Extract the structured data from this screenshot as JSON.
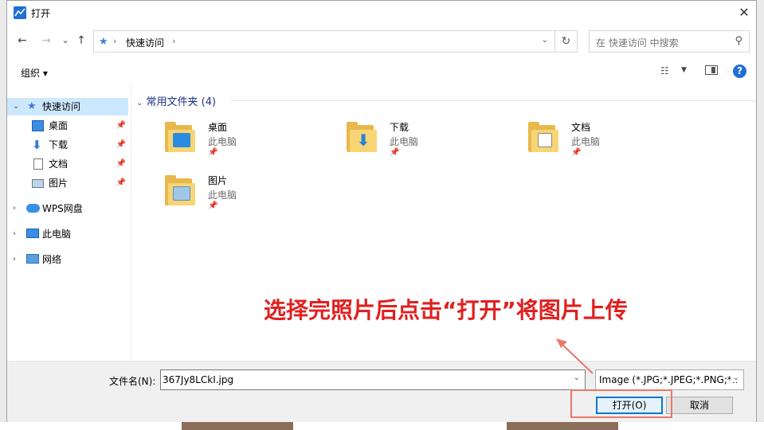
{
  "window": {
    "title": "打开"
  },
  "nav": {
    "back": "←",
    "forward": "→",
    "recent": "⌄",
    "up": "↑",
    "breadcrumb": "快速访问",
    "search_placeholder": "在 快速访问 中搜索"
  },
  "commandbar": {
    "organize": "组织 ▾"
  },
  "sidebar": {
    "items": [
      {
        "label": "快速访问",
        "icon": "star-pin-icon"
      },
      {
        "label": "桌面",
        "icon": "desktop-icon",
        "pinned": true
      },
      {
        "label": "下载",
        "icon": "download-icon",
        "pinned": true
      },
      {
        "label": "文档",
        "icon": "document-icon",
        "pinned": true
      },
      {
        "label": "图片",
        "icon": "pictures-icon",
        "pinned": true
      },
      {
        "label": "WPS网盘",
        "icon": "cloud-icon"
      },
      {
        "label": "此电脑",
        "icon": "computer-icon"
      },
      {
        "label": "网络",
        "icon": "network-icon"
      }
    ]
  },
  "main": {
    "group_header": "常用文件夹 (4)",
    "folders": [
      {
        "name": "桌面",
        "location": "此电脑"
      },
      {
        "name": "下载",
        "location": "此电脑"
      },
      {
        "name": "文档",
        "location": "此电脑"
      },
      {
        "name": "图片",
        "location": "此电脑"
      }
    ]
  },
  "annotation": {
    "text": "选择完照片后点击“打开”将图片上传"
  },
  "footer": {
    "filename_label": "文件名(N):",
    "filename_value": "367Jy8LCkI.jpg",
    "filetype_value": "Image (*.JPG;*.JPEG;*.PNG;*.I",
    "open_button": "打开(O)",
    "cancel_button": "取消"
  },
  "colors": {
    "accent": "#0078d7",
    "annotation": "#e02020",
    "highlight": "#e8786a",
    "folder": "#f7d574"
  }
}
